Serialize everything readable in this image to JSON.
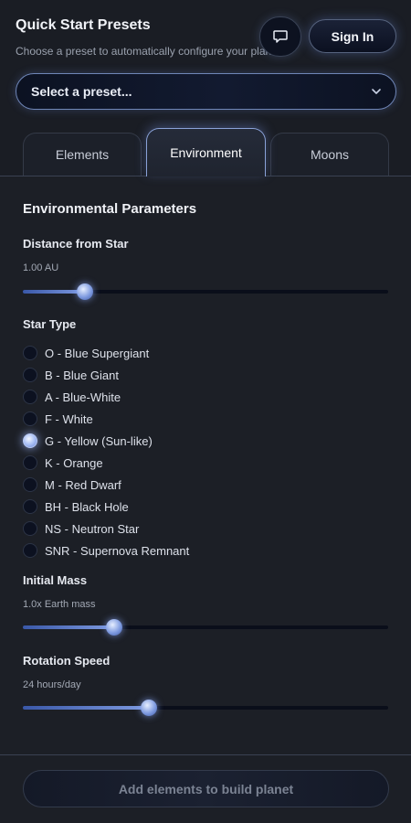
{
  "header": {
    "title": "Quick Start Presets",
    "subtitle": "Choose a preset to automatically configure your planet",
    "sign_in_label": "Sign In"
  },
  "preset": {
    "selected": "Select a preset..."
  },
  "tabs": [
    {
      "label": "Elements",
      "active": false
    },
    {
      "label": "Environment",
      "active": true
    },
    {
      "label": "Moons",
      "active": false
    }
  ],
  "environment": {
    "section_title": "Environmental Parameters",
    "distance": {
      "label": "Distance from Star",
      "value_text": "1.00 AU",
      "fraction": 0.17
    },
    "star_type": {
      "label": "Star Type",
      "options": [
        "O - Blue Supergiant",
        "B - Blue Giant",
        "A - Blue-White",
        "F - White",
        "G - Yellow (Sun-like)",
        "K - Orange",
        "M - Red Dwarf",
        "BH - Black Hole",
        "NS - Neutron Star",
        "SNR - Supernova Remnant"
      ],
      "selected_index": 4
    },
    "mass": {
      "label": "Initial Mass",
      "value_text": "1.0x Earth mass",
      "fraction": 0.25
    },
    "rotation": {
      "label": "Rotation Speed",
      "value_text": "24 hours/day",
      "fraction": 0.345
    }
  },
  "footer": {
    "build_label": "Add elements to build planet"
  },
  "colors": {
    "accent": "#7e9ae0",
    "background": "#1c1f26"
  },
  "icons": {
    "chat": "chat-bubble-icon",
    "dropdown": "chevron-down-icon"
  }
}
